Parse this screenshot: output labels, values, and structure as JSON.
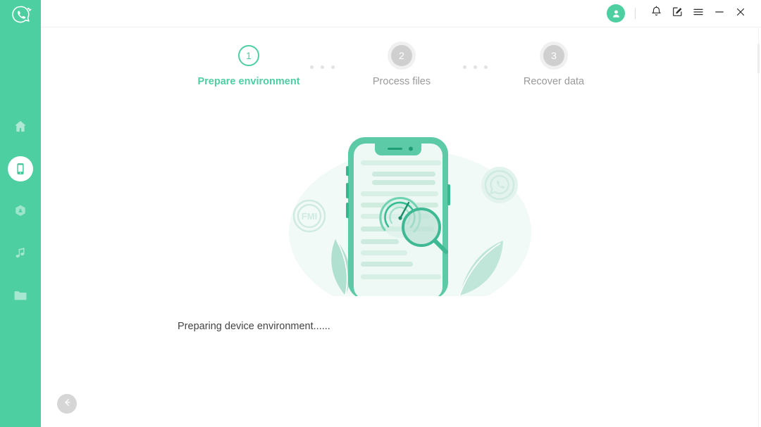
{
  "app": {
    "brand_icon": "whatsapp-recovery-logo",
    "sidebar_color": "#4ecfa2",
    "accent_color": "#4ecfa2"
  },
  "sidebar": {
    "items": [
      {
        "name": "home",
        "icon": "home-icon",
        "active": false
      },
      {
        "name": "device",
        "icon": "phone-icon",
        "active": true
      },
      {
        "name": "cloud",
        "icon": "cloud-icon",
        "active": false
      },
      {
        "name": "music",
        "icon": "music-note-icon",
        "active": false
      },
      {
        "name": "files",
        "icon": "folder-icon",
        "active": false
      }
    ]
  },
  "titlebar": {
    "avatar_icon": "user-avatar-icon",
    "buttons": [
      {
        "name": "notifications",
        "icon": "bell-icon"
      },
      {
        "name": "feedback",
        "icon": "edit-square-icon"
      },
      {
        "name": "menu",
        "icon": "hamburger-menu-icon"
      },
      {
        "name": "minimize",
        "icon": "minimize-icon"
      },
      {
        "name": "close",
        "icon": "close-icon"
      }
    ]
  },
  "steps": {
    "items": [
      {
        "number": "1",
        "label": "Prepare environment",
        "state": "active"
      },
      {
        "number": "2",
        "label": "Process files",
        "state": "idle"
      },
      {
        "number": "3",
        "label": "Recover data",
        "state": "idle"
      }
    ]
  },
  "illustration": {
    "name": "device-scan-illustration",
    "badges": [
      {
        "name": "fmi-badge",
        "label": "FMI"
      },
      {
        "name": "whatsapp-badge",
        "label": ""
      }
    ],
    "elements": [
      "phone",
      "gauge",
      "magnifier",
      "leaves",
      "text-lines"
    ]
  },
  "main": {
    "status_text": "Preparing device environment......"
  },
  "footer": {
    "back_icon": "arrow-left-icon"
  }
}
